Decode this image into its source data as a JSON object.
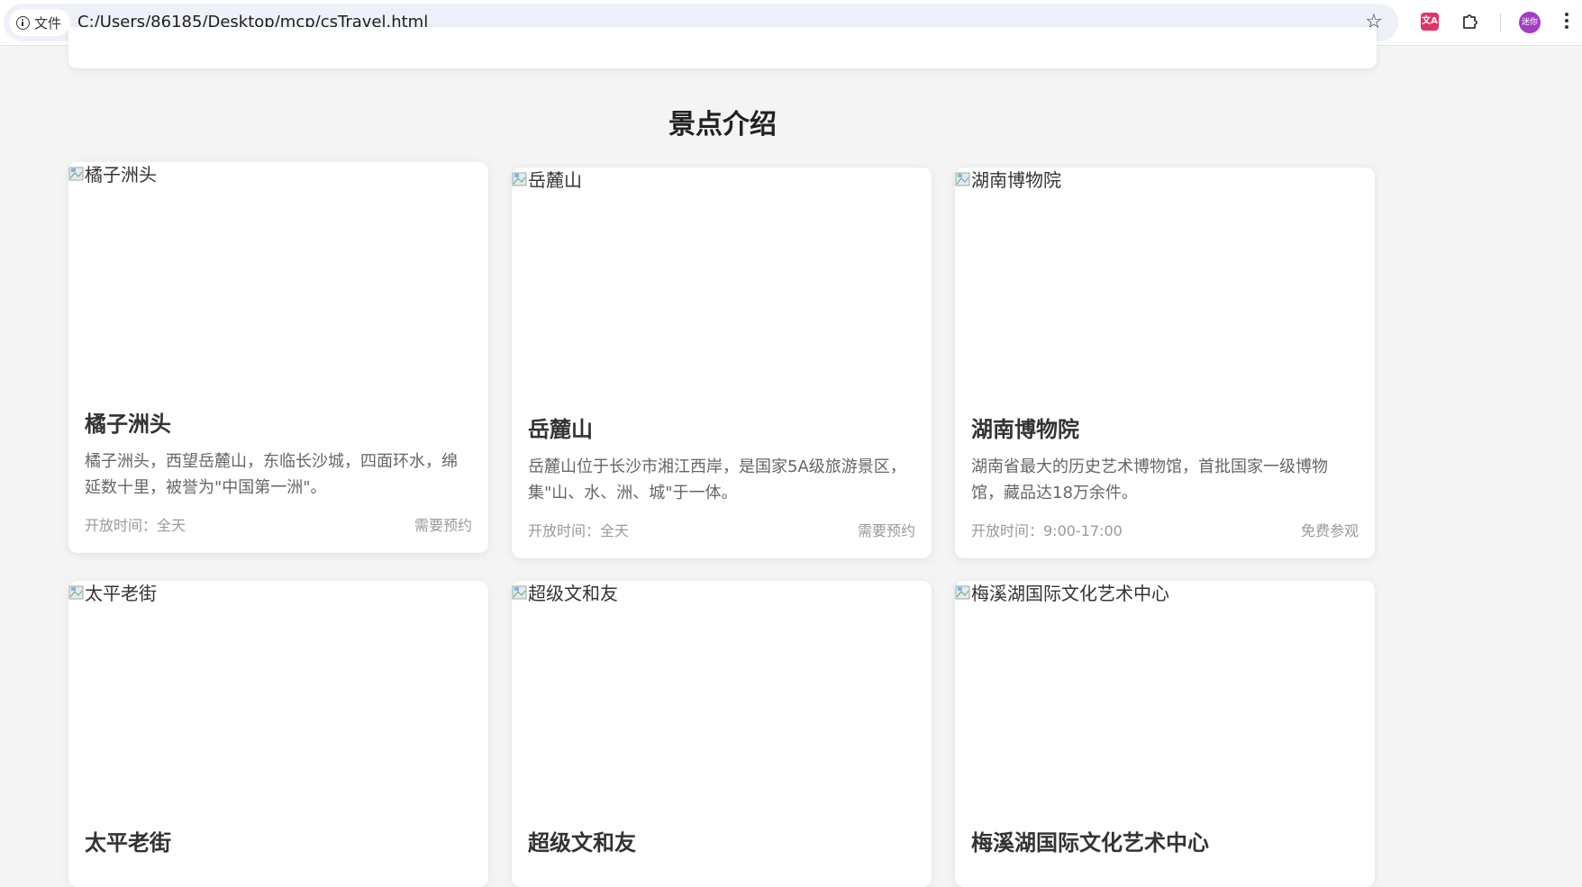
{
  "browser": {
    "site_info_label": "文件",
    "url": "C:/Users/86185/Desktop/mcp/csTravel.html",
    "profile_label": "迷你",
    "translate_label": "文A"
  },
  "section": {
    "title": "景点介绍"
  },
  "attractions": [
    {
      "image_alt": "橘子洲头",
      "name": "橘子洲头",
      "description": "橘子洲头，西望岳麓山，东临长沙城，四面环水，绵延数十里，被誉为\"中国第一洲\"。",
      "hours": "开放时间：全天",
      "note": "需要预约"
    },
    {
      "image_alt": "岳麓山",
      "name": "岳麓山",
      "description": "岳麓山位于长沙市湘江西岸，是国家5A级旅游景区，集\"山、水、洲、城\"于一体。",
      "hours": "开放时间：全天",
      "note": "需要预约"
    },
    {
      "image_alt": "湖南博物院",
      "name": "湖南博物院",
      "description": "湖南省最大的历史艺术博物馆，首批国家一级博物馆，藏品达18万余件。",
      "hours": "开放时间：9:00-17:00",
      "note": "免费参观"
    },
    {
      "image_alt": "太平老街",
      "name": "太平老街"
    },
    {
      "image_alt": "超级文和友",
      "name": "超级文和友"
    },
    {
      "image_alt": "梅溪湖国际文化艺术中心",
      "name": "梅溪湖国际文化艺术中心"
    }
  ]
}
